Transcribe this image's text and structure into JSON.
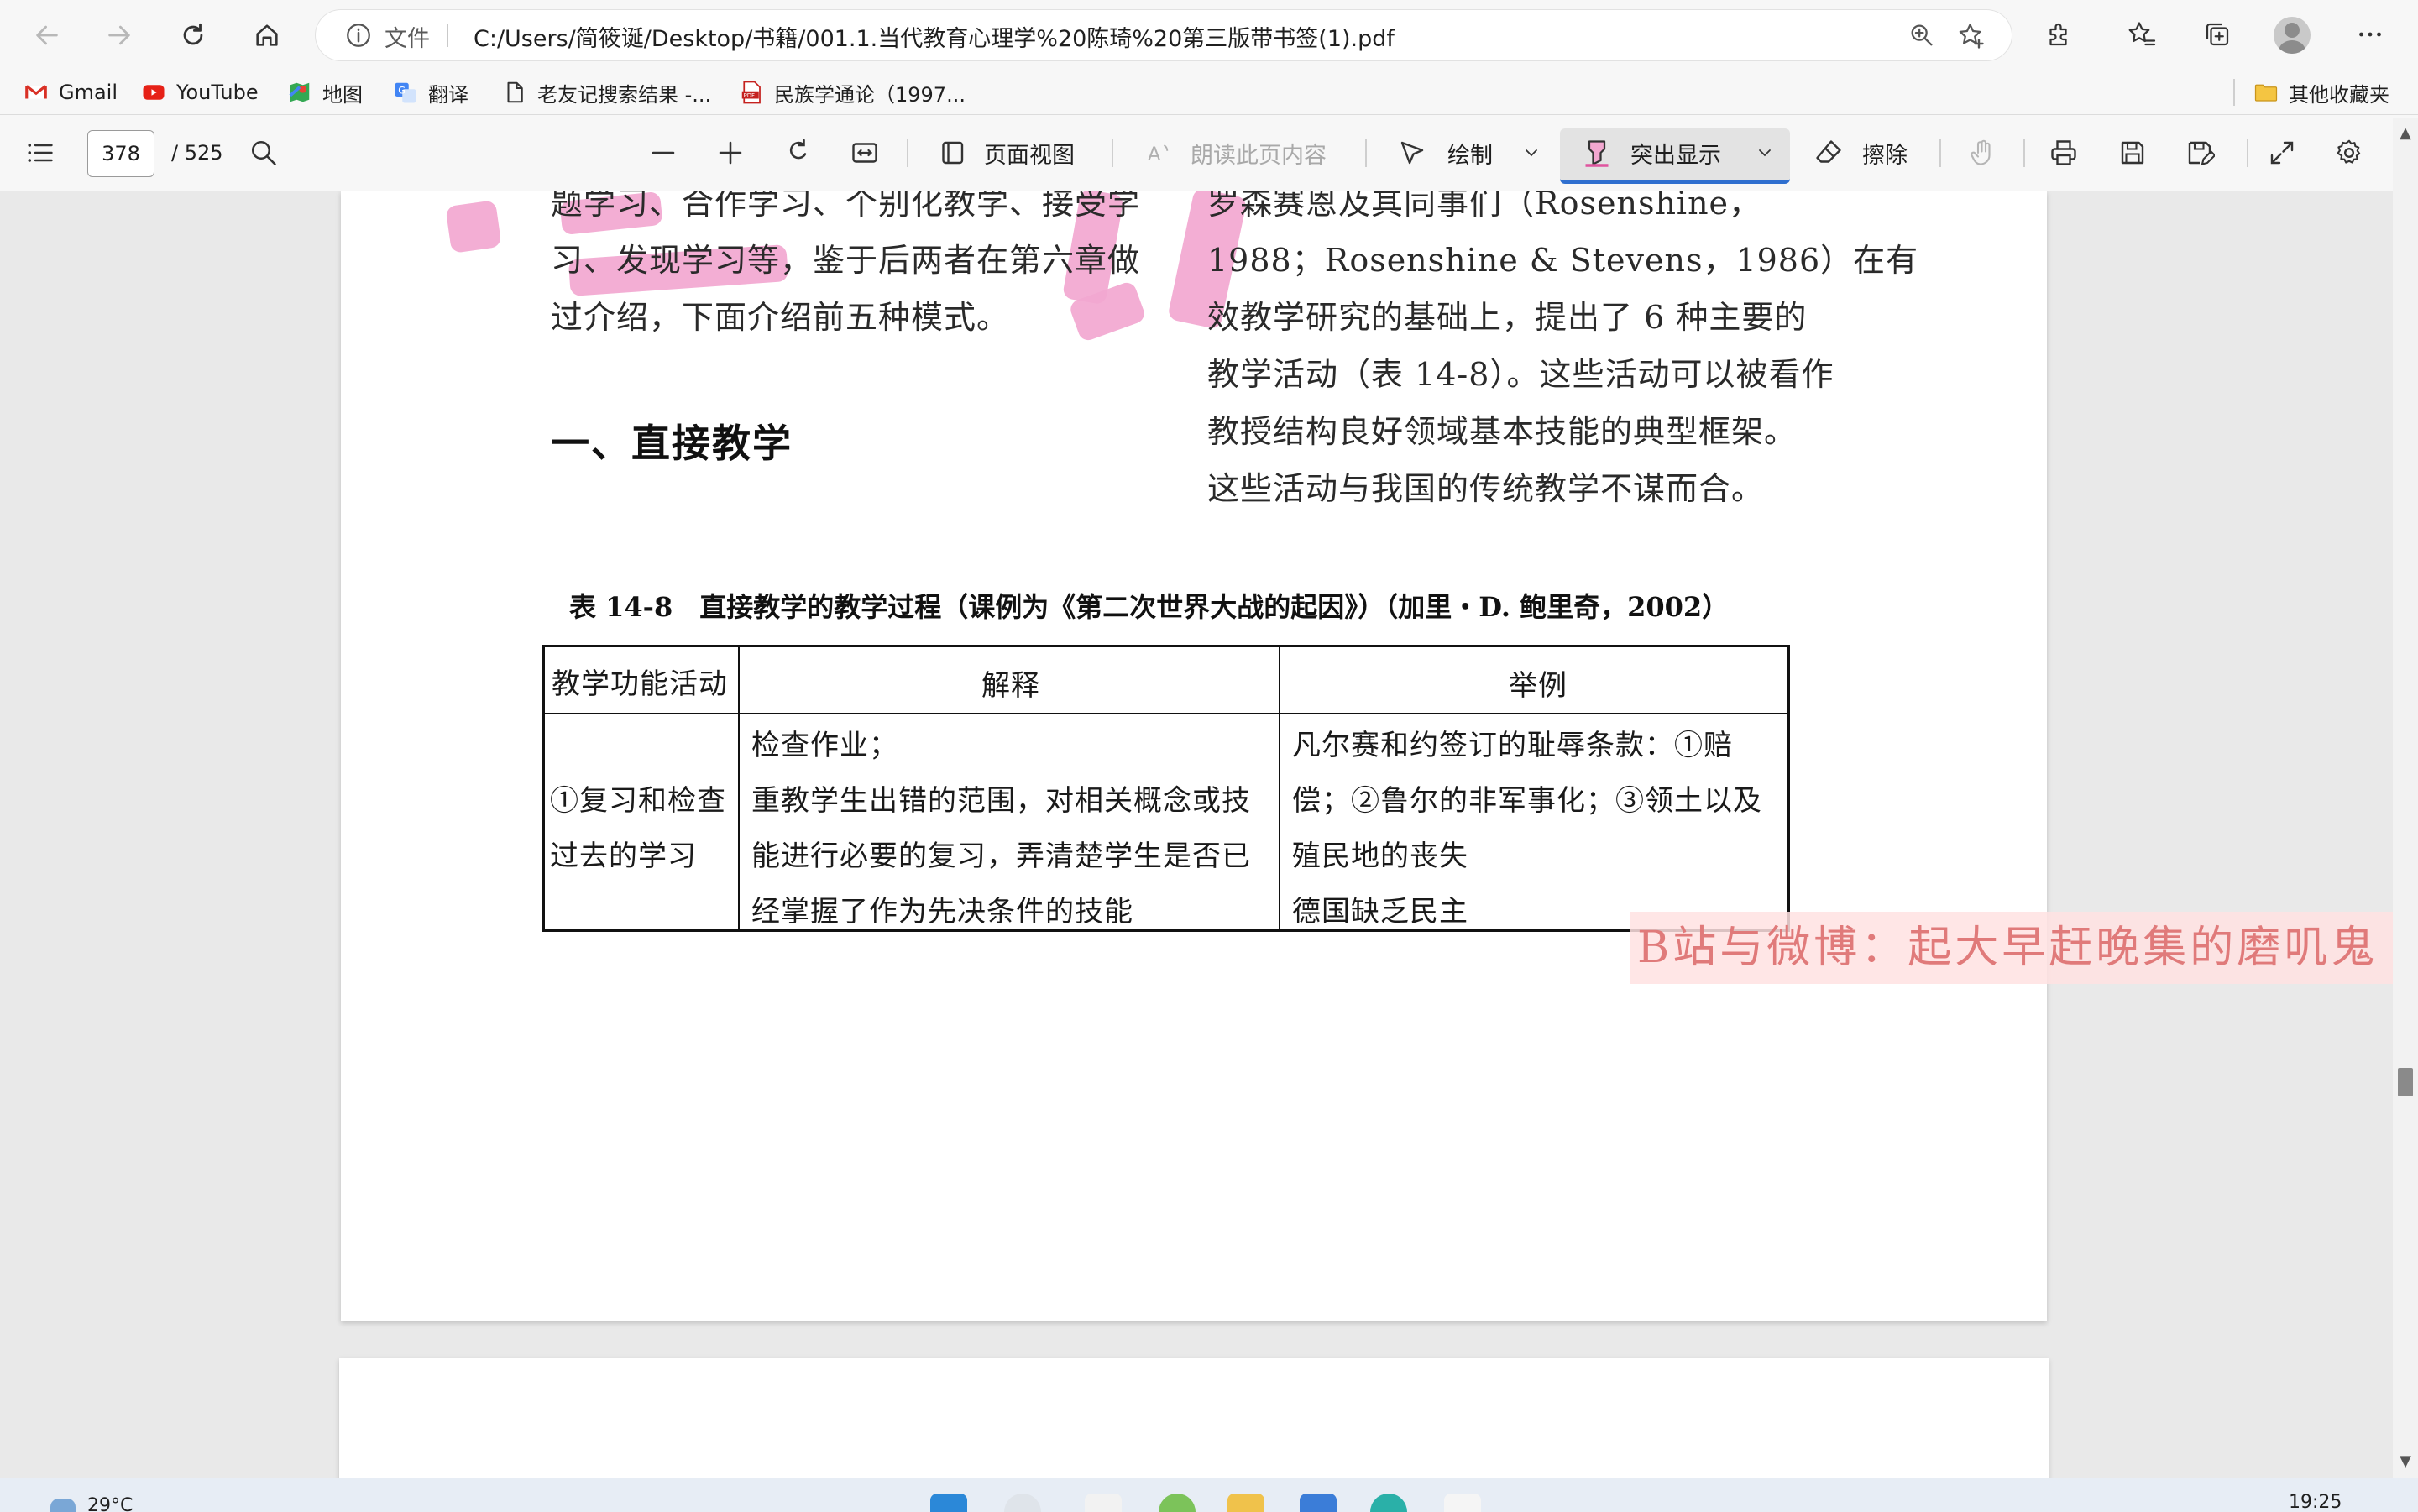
{
  "browser": {
    "scheme_label": "文件",
    "url": "C:/Users/简筱诞/Desktop/书籍/001.1.当代教育心理学%20陈琦%20第三版带书签(1).pdf"
  },
  "bookmarks": {
    "items": [
      {
        "label": "Gmail",
        "icon": "gmail-icon"
      },
      {
        "label": "YouTube",
        "icon": "youtube-icon"
      },
      {
        "label": "地图",
        "icon": "maps-icon"
      },
      {
        "label": "翻译",
        "icon": "translate-icon"
      },
      {
        "label": "老友记搜索结果 -...",
        "icon": "page-icon"
      },
      {
        "label": "民族学通论（1997...",
        "icon": "pdf-icon"
      }
    ],
    "other_folder": "其他收藏夹"
  },
  "pdf_toolbar": {
    "page_current": "378",
    "page_total": "/ 525",
    "page_view_label": "页面视图",
    "read_aloud_label": "朗读此页内容",
    "draw_label": "绘制",
    "highlight_label": "突出显示",
    "erase_label": "擦除",
    "accent_color": "#2f6fcf"
  },
  "document": {
    "left_lines": [
      "题学习、合作学习、个别化教学、接受学",
      "习、发现学习等，鉴于后两者在第六章做",
      "过介绍，下面介绍前五种模式。"
    ],
    "heading": "一、直接教学",
    "right_lines": [
      "罗森赛恩及其同事们（Rosenshine，",
      "1988；Rosenshine & Stevens，1986）在有",
      "效教学研究的基础上，提出了 6 种主要的",
      "教学活动（表 14-8）。这些活动可以被看作",
      "教授结构良好领域基本技能的典型框架。",
      "这些活动与我国的传统教学不谋而合。"
    ],
    "table_caption": "表 14-8　直接教学的教学过程（课例为《第二次世界大战的起因》）（加里・D. 鲍里奇，2002）",
    "table": {
      "headers": [
        "教学功能活动",
        "解释",
        "举例"
      ],
      "row": {
        "activity": [
          "①复习和检查",
          "过去的学习"
        ],
        "explanation": [
          "检查作业；",
          "重教学生出错的范围，对相关概念或技",
          "能进行必要的复习，弄清楚学生是否已",
          "经掌握了作为先决条件的技能"
        ],
        "example": [
          "凡尔赛和约签订的耻辱条款：①赔",
          "偿；②鲁尔的非军事化；③领土以及",
          "殖民地的丧失",
          "德国缺乏民主"
        ]
      }
    },
    "highlight_color": "#f2a7d0"
  },
  "watermark": "B站与微博：起大早赶晚集的磨叽鬼",
  "taskbar": {
    "weather": "29°C",
    "time": "19:25"
  }
}
